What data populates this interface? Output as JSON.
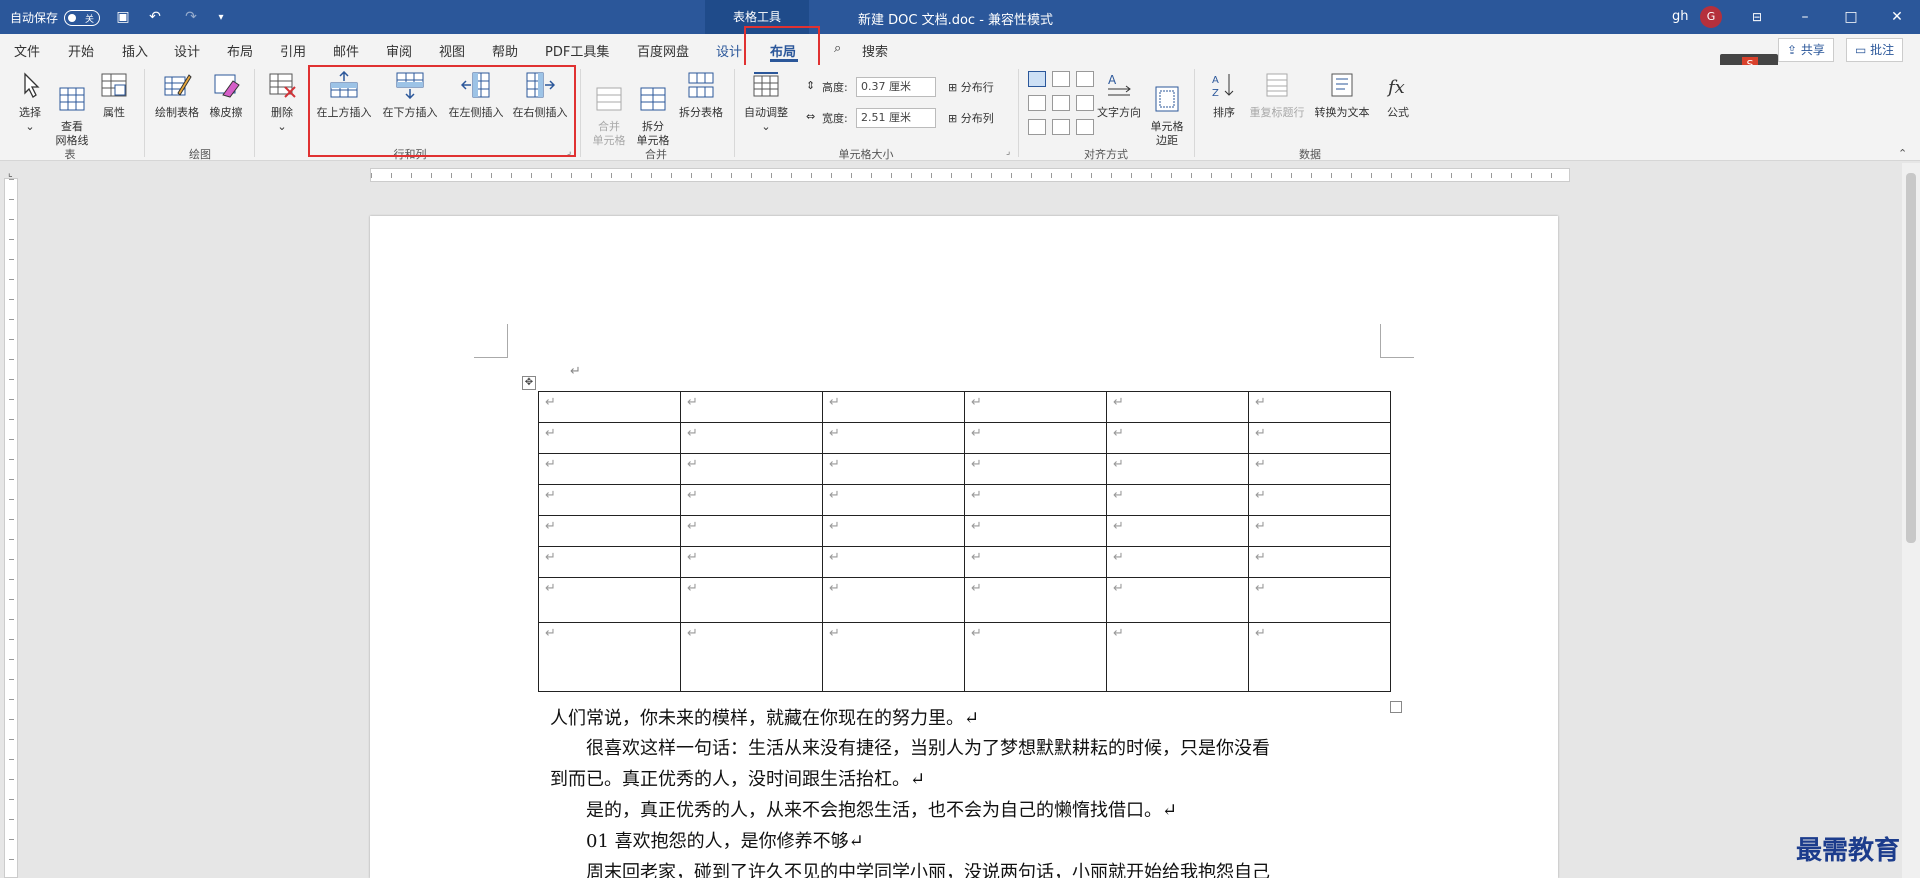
{
  "titlebar": {
    "autosave_label": "自动保存",
    "autosave_state": "关",
    "context_tab": "表格工具",
    "doc_title": "新建 DOC 文档.doc  -  兼容性模式",
    "user_name": "gh",
    "avatar_initial": "G"
  },
  "tabs": [
    "文件",
    "开始",
    "插入",
    "设计",
    "布局",
    "引用",
    "邮件",
    "审阅",
    "视图",
    "帮助",
    "PDF工具集",
    "百度网盘",
    "设计",
    "布局"
  ],
  "search_label": "搜索",
  "share_label": "共享",
  "comment_label": "批注",
  "ribbon": {
    "table_group": {
      "label": "表",
      "select": "选择",
      "gridlines": "查看\n网格线",
      "properties": "属性"
    },
    "draw_group": {
      "label": "绘图",
      "draw_table": "绘制表格",
      "eraser": "橡皮擦"
    },
    "rowcol_group": {
      "label": "行和列",
      "delete": "删除",
      "insert_above": "在上方插入",
      "insert_below": "在下方插入",
      "insert_left": "在左侧插入",
      "insert_right": "在右侧插入"
    },
    "merge_group": {
      "label": "合并",
      "merge_cells": "合并\n单元格",
      "split_cells": "拆分\n单元格",
      "split_table": "拆分表格"
    },
    "cellsize_group": {
      "label": "单元格大小",
      "autofit": "自动调整",
      "height_label": "高度:",
      "height_value": "0.37 厘米",
      "width_label": "宽度:",
      "width_value": "2.51 厘米",
      "distribute_rows": "分布行",
      "distribute_cols": "分布列"
    },
    "align_group": {
      "label": "对齐方式",
      "text_direction": "文字方向",
      "cell_margins": "单元格\n边距"
    },
    "data_group": {
      "label": "数据",
      "sort": "排序",
      "repeat_header": "重复标题行",
      "convert_text": "转换为文本",
      "formula": "公式"
    }
  },
  "document": {
    "paragraph_mark": "↵",
    "table_rows": 8,
    "table_cols": 6,
    "paragraphs": [
      "人们常说，你未来的模样，就藏在你现在的努力里。↵",
      "　　很喜欢这样一句话：生活从来没有捷径，当别人为了梦想默默耕耘的时候，只是你没看",
      "到而已。真正优秀的人，没时间跟生活抬杠。↵",
      "　　是的，真正优秀的人，从来不会抱怨生活，也不会为自己的懒惰找借口。↵",
      "　　01  喜欢抱怨的人，是你修养不够↵",
      "　　周末回老家，碰到了许久不见的中学同学小丽，没说两句话，小丽就开始给我抱怨自己"
    ]
  },
  "watermark": "最需教育",
  "colors": {
    "accent": "#2b579a",
    "highlight": "#e03131"
  }
}
